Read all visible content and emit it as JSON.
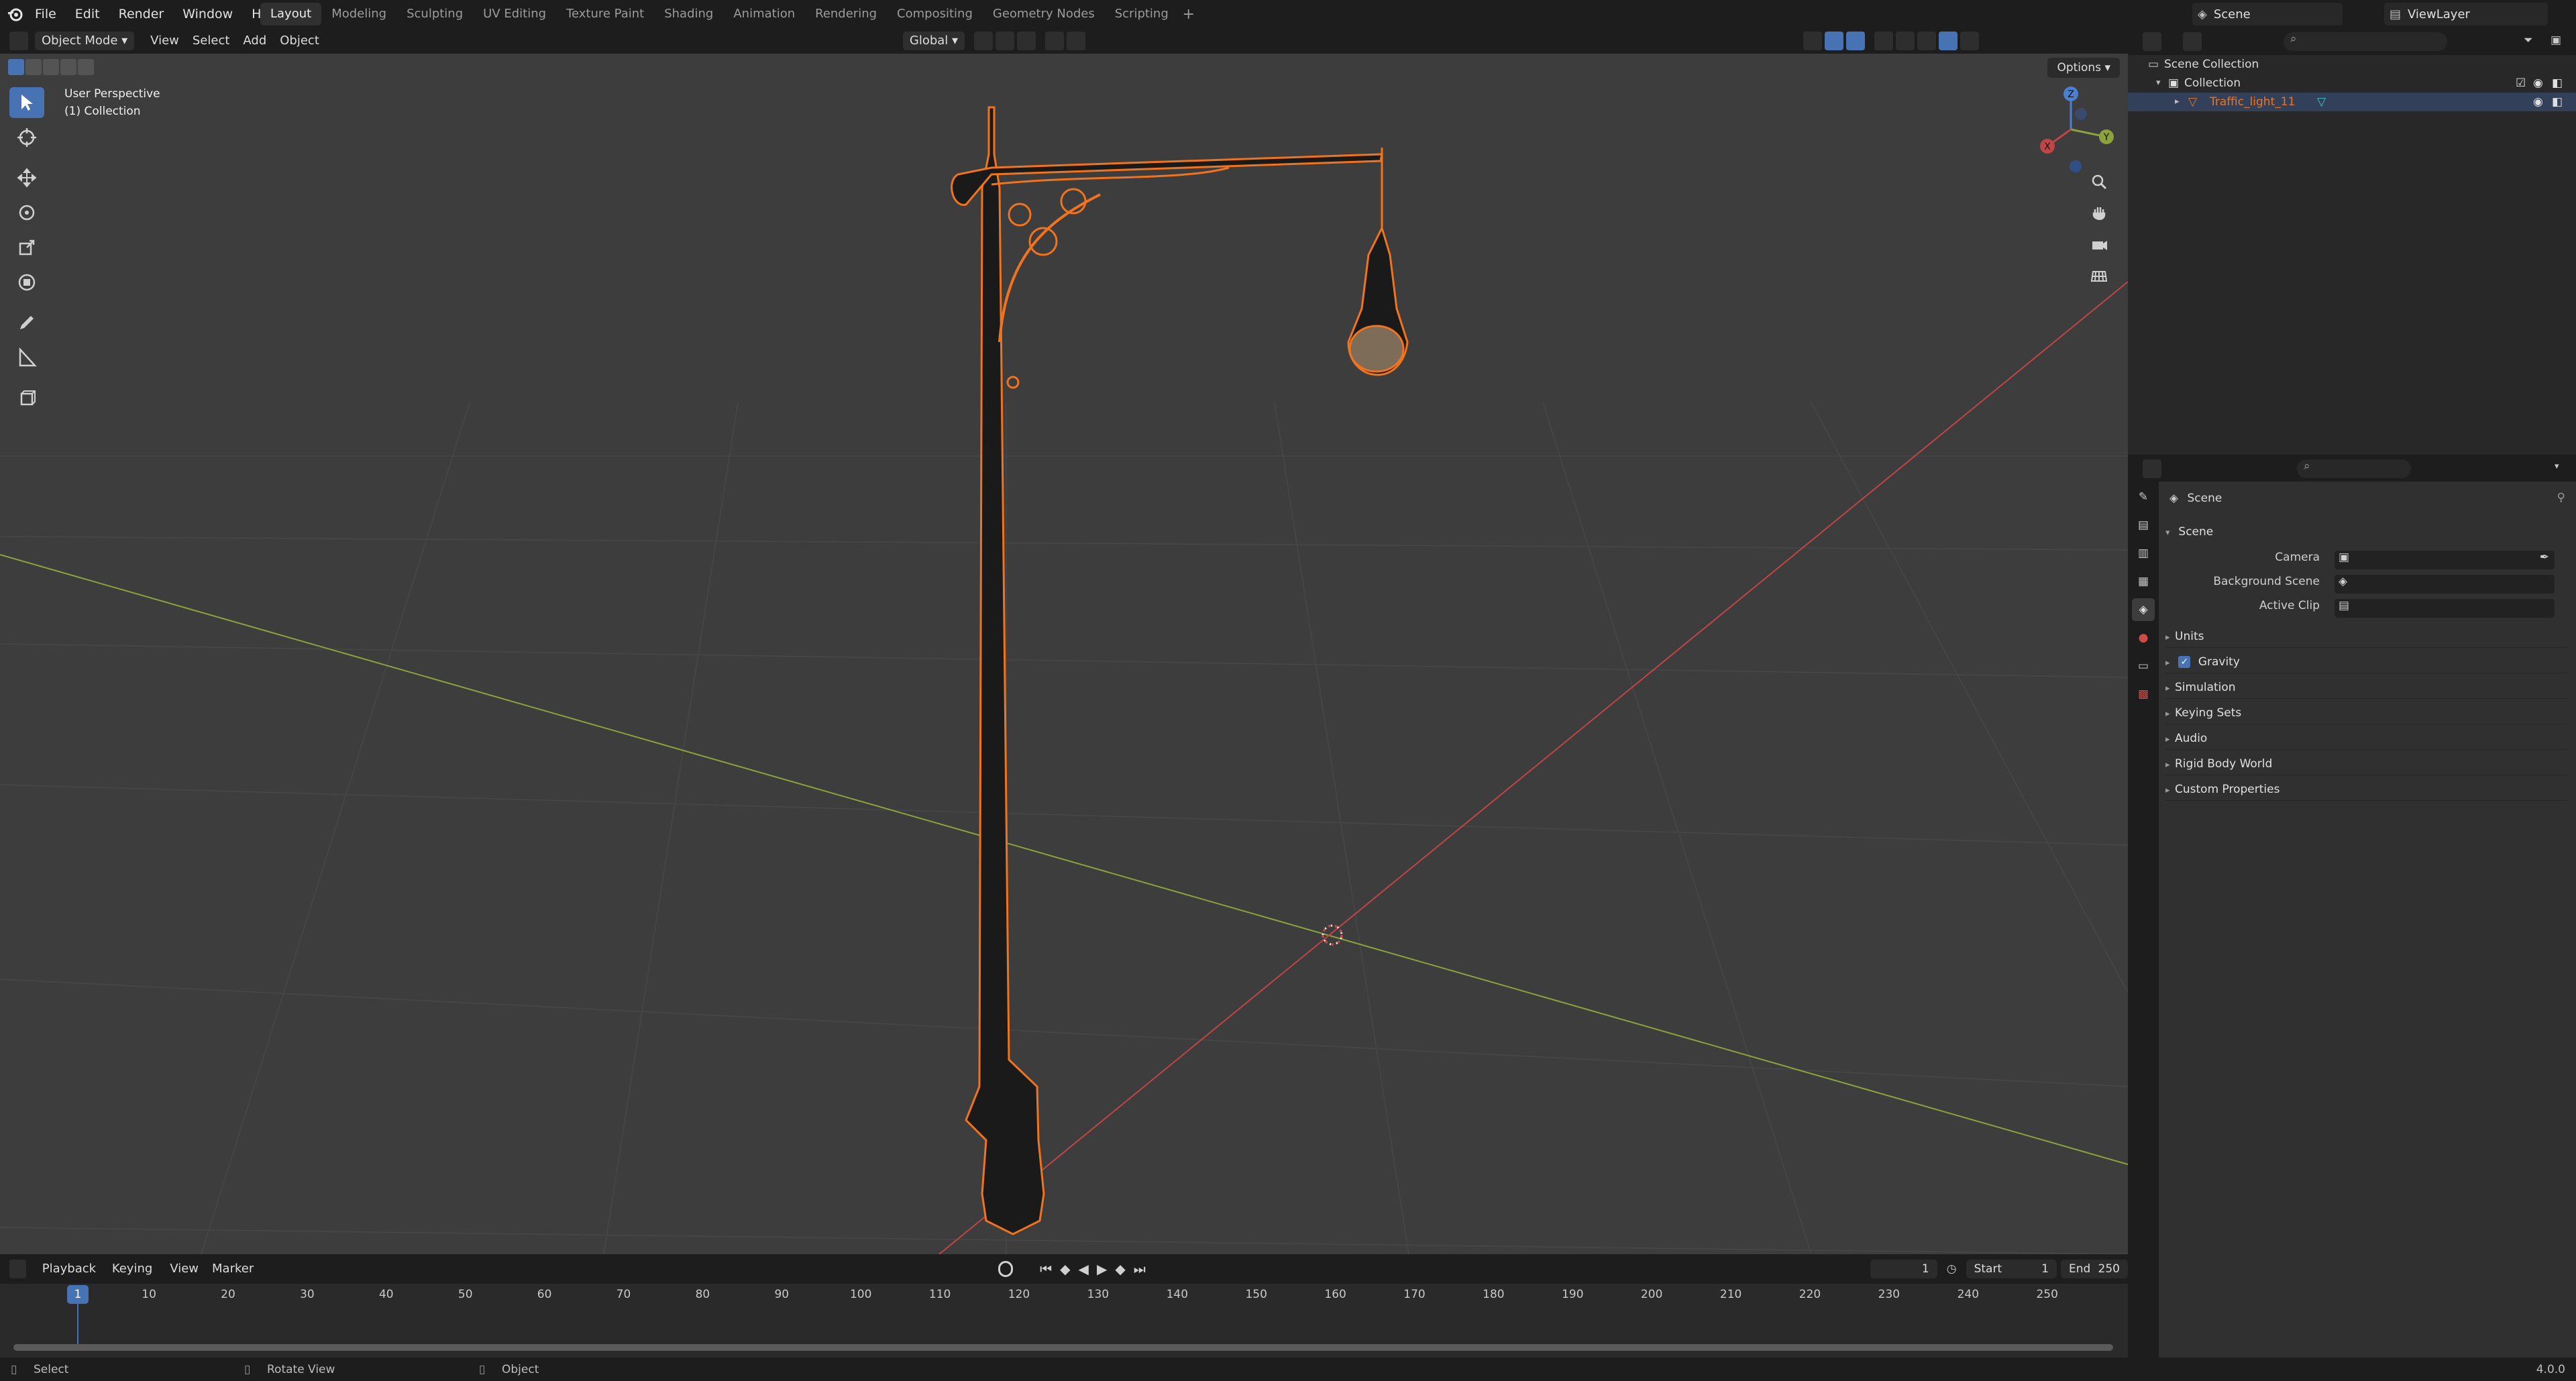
{
  "topbar": {
    "menus": [
      "File",
      "Edit",
      "Render",
      "Window",
      "Help"
    ],
    "workspaces": [
      "Layout",
      "Modeling",
      "Sculpting",
      "UV Editing",
      "Texture Paint",
      "Shading",
      "Animation",
      "Rendering",
      "Compositing",
      "Geometry Nodes",
      "Scripting"
    ],
    "active_workspace": "Layout",
    "scene": "Scene",
    "view_layer": "ViewLayer"
  },
  "viewport_header": {
    "mode": "Object Mode",
    "menus": [
      "View",
      "Select",
      "Add",
      "Object"
    ],
    "transform_orientation": "Global",
    "options": "Options"
  },
  "viewport": {
    "perspective_label": "User Perspective",
    "collection_label": "(1) Collection"
  },
  "timeline": {
    "menus": [
      "Playback",
      "Keying",
      "View",
      "Marker"
    ],
    "current_frame": "1",
    "start_label": "Start",
    "start": "1",
    "end_label": "End",
    "end": "250",
    "frames": [
      "10",
      "20",
      "30",
      "40",
      "50",
      "60",
      "70",
      "80",
      "90",
      "100",
      "110",
      "120",
      "130",
      "140",
      "150",
      "160",
      "170",
      "180",
      "190",
      "200",
      "210",
      "220",
      "230",
      "240",
      "250"
    ],
    "current_marker": "1"
  },
  "outliner": {
    "scene_collection": "Scene Collection",
    "collection": "Collection",
    "object": "Traffic_light_11"
  },
  "properties": {
    "context": "Scene",
    "panel_title": "Scene",
    "fields": [
      {
        "label": "Camera"
      },
      {
        "label": "Background Scene"
      },
      {
        "label": "Active Clip"
      }
    ],
    "panels": [
      "Units",
      "Gravity",
      "Simulation",
      "Keying Sets",
      "Audio",
      "Rigid Body World",
      "Custom Properties"
    ],
    "gravity_checked": true
  },
  "statusbar": {
    "left": "Select",
    "middle": "Rotate View",
    "right": "Object",
    "version": "4.0.0"
  },
  "colors": {
    "accent": "#4772b3",
    "selection_outline": "#f0741f",
    "x_axis": "#c04545",
    "y_axis": "#8ca23c"
  }
}
